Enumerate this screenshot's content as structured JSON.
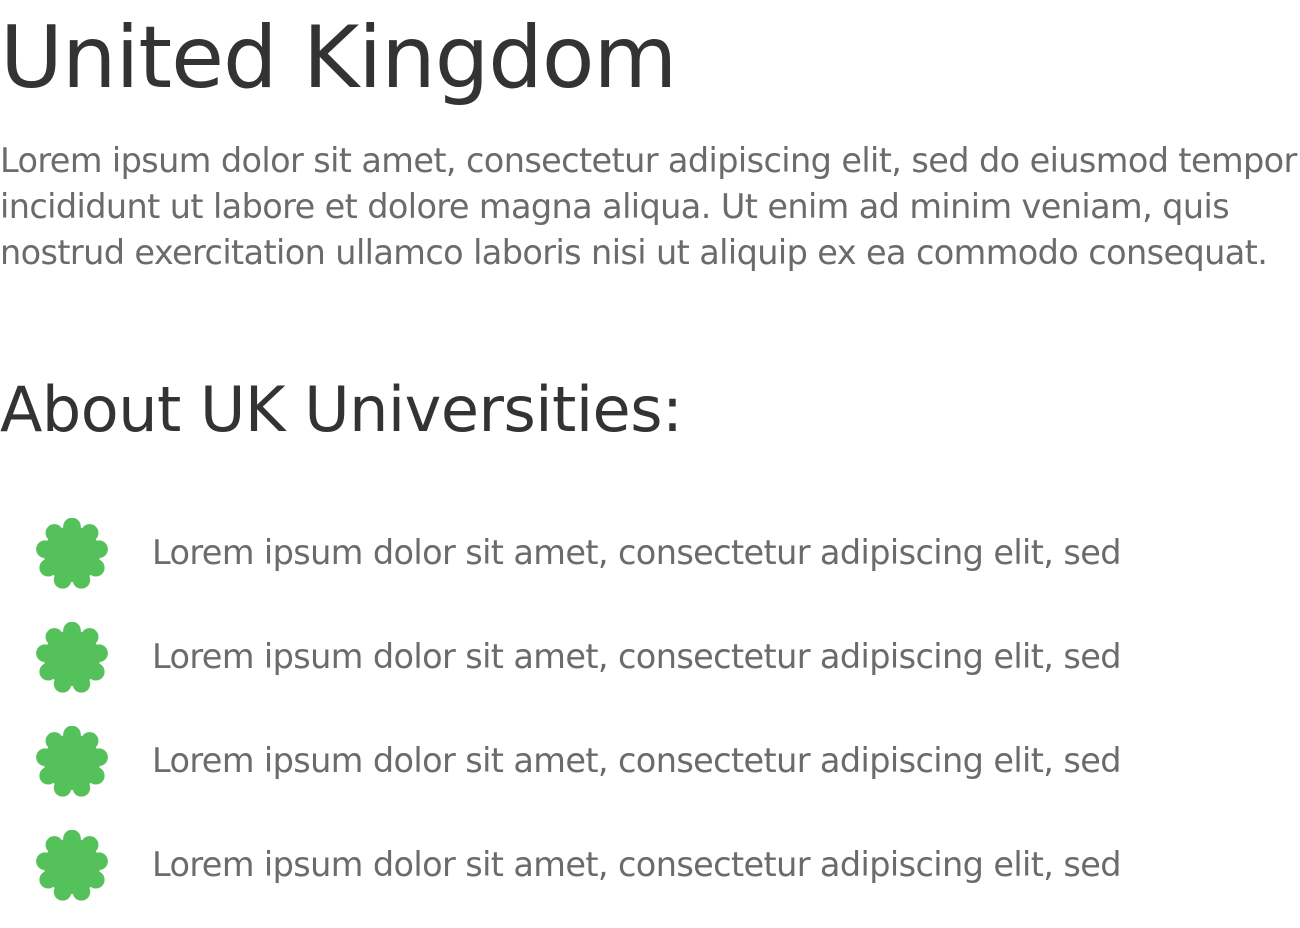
{
  "title": "United Kingdom",
  "intro": "Lorem ipsum dolor sit amet, consectetur adipiscing elit, sed do eiusmod tempor incididunt ut labore et dolore magna aliqua. Ut enim ad minim veniam, quis nostrud exercitation ullamco laboris nisi ut aliquip ex ea commodo consequat.",
  "section_heading": "About UK Universities:",
  "bullets": [
    {
      "icon": "badge-icon",
      "text": "Lorem ipsum dolor sit amet, consectetur adipiscing elit, sed"
    },
    {
      "icon": "badge-icon",
      "text": "Lorem ipsum dolor sit amet, consectetur adipiscing elit, sed"
    },
    {
      "icon": "badge-icon",
      "text": "Lorem ipsum dolor sit amet, consectetur adipiscing elit, sed"
    },
    {
      "icon": "badge-icon",
      "text": "Lorem ipsum dolor sit amet, consectetur adipiscing elit, sed"
    }
  ],
  "colors": {
    "heading": "#333333",
    "body_text": "#6b6b6b",
    "bullet_icon": "#55c15a"
  }
}
